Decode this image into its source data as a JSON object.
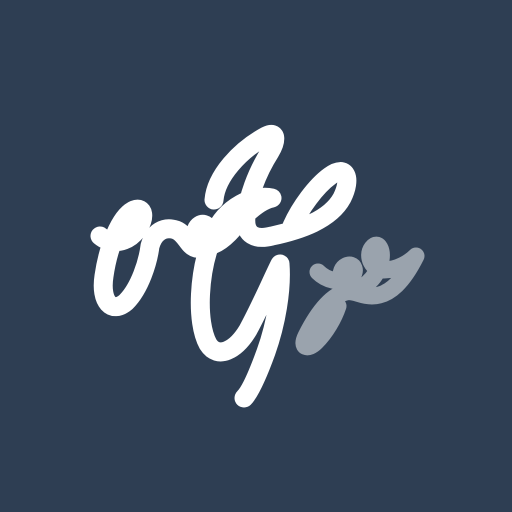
{
  "logo": {
    "icon_name": "script-monogram-logo",
    "background_color": "#2e3e53",
    "primary_stroke_color": "#ffffff",
    "secondary_stroke_color": "#9aa3ad"
  }
}
